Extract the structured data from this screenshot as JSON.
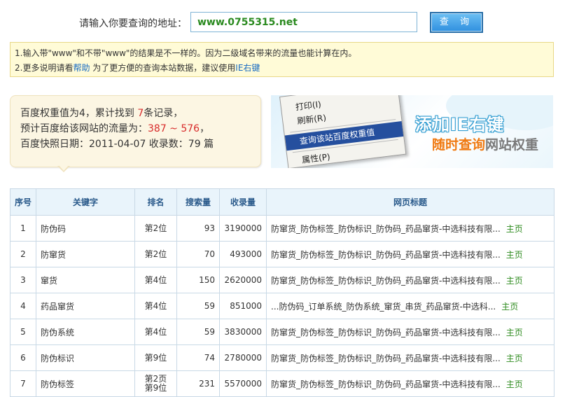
{
  "query": {
    "label": "请输入你要查询的地址：",
    "value": "www.0755315.net",
    "button": "查 询"
  },
  "notice": {
    "line1": "1.输入带\"www\"和不带\"www\"的结果是不一样的。因为二级域名带来的流量也能计算在内。",
    "line2_prefix": "2.更多说明请看",
    "line2_help": "帮助",
    "line2_middle": " 为了更方便的查询本站数据，建议使用",
    "line2_link": "IE右键"
  },
  "stats": {
    "l1_prefix": "百度权重值为4，累计找到 ",
    "l1_count": "7",
    "l1_suffix": "条记录，",
    "l2_prefix": "预计百度给该网站的流量为：",
    "l2_range": "387 ~ 576",
    "l2_suffix": "，",
    "l3": "百度快照日期：2011-04-07 收录数：79 篇"
  },
  "banner": {
    "menu_print": "打印(I)",
    "menu_refresh": "刷新(R)",
    "menu_query": "查询该站百度权重值",
    "menu_props": "属性(P)",
    "title": "添加IE右键",
    "sub_orange": "随时查询",
    "sub_gray": "网站权重"
  },
  "table": {
    "headers": [
      "序号",
      "关键字",
      "排名",
      "搜索量",
      "收录量",
      "网页标题"
    ],
    "rows": [
      {
        "idx": "1",
        "kw": "防伪码",
        "rank": "第2位",
        "search": "93",
        "indexed": "3190000",
        "title": "防窜货_防伪标签_防伪标识_防伪码_药品窜货-中选科技有限...",
        "home": "主页"
      },
      {
        "idx": "2",
        "kw": "防窜货",
        "rank": "第2位",
        "search": "70",
        "indexed": "493000",
        "title": "防窜货_防伪标签_防伪标识_防伪码_药品窜货-中选科技有限...",
        "home": "主页"
      },
      {
        "idx": "3",
        "kw": "窜货",
        "rank": "第4位",
        "search": "150",
        "indexed": "2620000",
        "title": "防窜货_防伪标签_防伪标识_防伪码_药品窜货-中选科技有限...",
        "home": "主页"
      },
      {
        "idx": "4",
        "kw": "药品窜货",
        "rank": "第4位",
        "search": "59",
        "indexed": "851000",
        "title": "...防伪码_订单系统_防伪系统_窜货_串货_药品窜货-中选科...",
        "home": "主页"
      },
      {
        "idx": "5",
        "kw": "防伪系统",
        "rank": "第4位",
        "search": "59",
        "indexed": "3830000",
        "title": "防窜货_防伪标签_防伪标识_防伪码_药品窜货-中选科技有限...",
        "home": "主页"
      },
      {
        "idx": "6",
        "kw": "防伪标识",
        "rank": "第9位",
        "search": "74",
        "indexed": "2780000",
        "title": "防窜货_防伪标签_防伪标识_防伪码_药品窜货-中选科技有限...",
        "home": "主页"
      },
      {
        "idx": "7",
        "kw": "防伪标签",
        "rank": "第2页\n第9位",
        "search": "231",
        "indexed": "5570000",
        "title": "防窜货_防伪标签_防伪标识_防伪码_药品窜货-中选科技有限...",
        "home": "主页"
      }
    ]
  }
}
